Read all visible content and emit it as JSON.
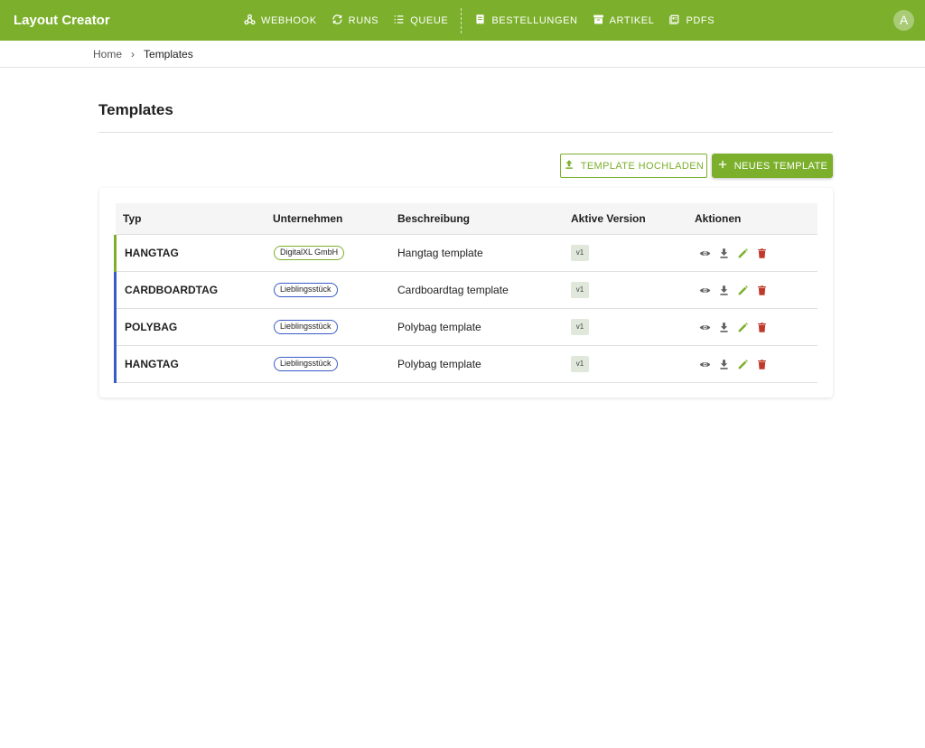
{
  "app": {
    "title": "Layout Creator",
    "user_initial": "A"
  },
  "nav": [
    {
      "label": "WEBHOOK",
      "icon": "webhook-icon"
    },
    {
      "label": "RUNS",
      "icon": "runs-icon"
    },
    {
      "label": "QUEUE",
      "icon": "queue-icon"
    },
    {
      "label": "BESTELLUNGEN",
      "icon": "receipt-icon"
    },
    {
      "label": "ARTIKEL",
      "icon": "archive-icon"
    },
    {
      "label": "PDFS",
      "icon": "pdf-icon"
    }
  ],
  "breadcrumb": {
    "home": "Home",
    "current": "Templates"
  },
  "page": {
    "title": "Templates"
  },
  "buttons": {
    "upload": "TEMPLATE HOCHLADEN",
    "new": "NEUES TEMPLATE"
  },
  "table": {
    "headers": {
      "typ": "Typ",
      "unternehmen": "Unternehmen",
      "beschreibung": "Beschreibung",
      "version": "Aktive Version",
      "aktionen": "Aktionen"
    },
    "rows": [
      {
        "typ": "HANGTAG",
        "company": "DigitalXL GmbH",
        "company_color": "#7cb02c",
        "description": "Hangtag template",
        "version": "v1",
        "accent": "#7cb02c"
      },
      {
        "typ": "CARDBOARDTAG",
        "company": "Lieblingsstück",
        "company_color": "#3a5bc7",
        "description": "Cardboardtag template",
        "version": "v1",
        "accent": "#3a5bc7"
      },
      {
        "typ": "POLYBAG",
        "company": "Lieblingsstück",
        "company_color": "#3a5bc7",
        "description": "Polybag template",
        "version": "v1",
        "accent": "#3a5bc7"
      },
      {
        "typ": "HANGTAG",
        "company": "Lieblingsstück",
        "company_color": "#3a5bc7",
        "description": "Polybag template",
        "version": "v1",
        "accent": "#3a5bc7"
      }
    ],
    "action_icons": [
      "eye-icon",
      "download-icon",
      "edit-icon",
      "delete-icon"
    ]
  },
  "colors": {
    "primary": "#7cb02c",
    "secondary": "#3a5bc7",
    "danger": "#c0392b",
    "icon_gray": "#616161"
  }
}
